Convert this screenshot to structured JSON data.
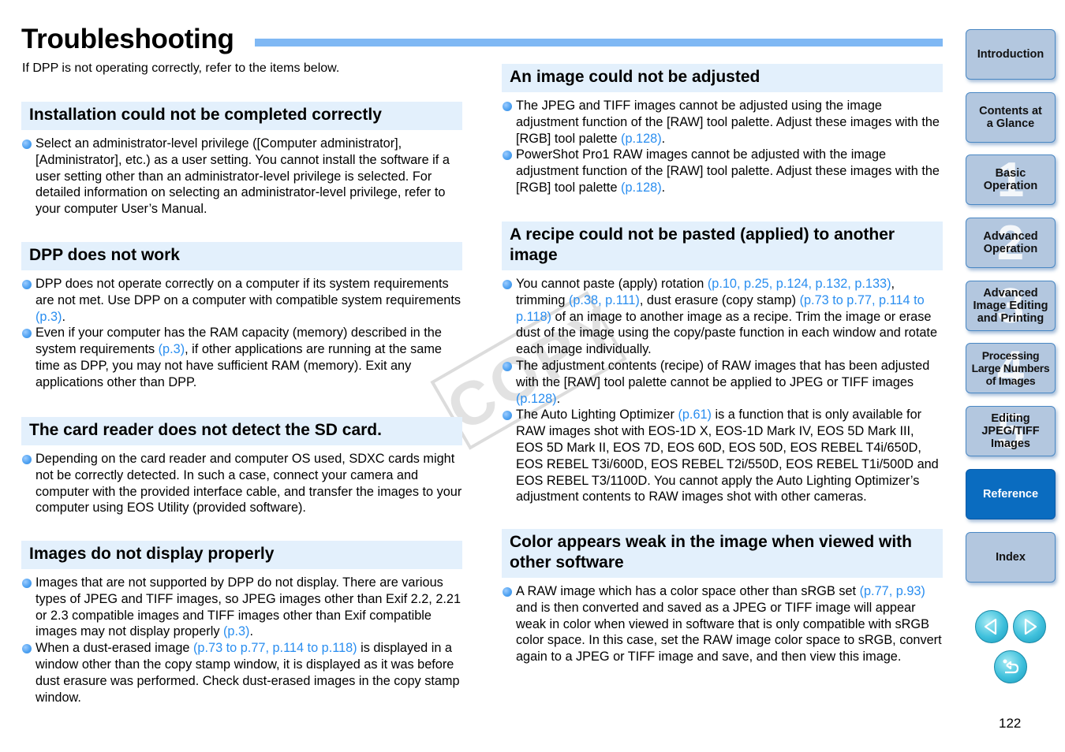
{
  "header": {
    "title": "Troubleshooting",
    "intro": "If DPP is not operating correctly, refer to the items below."
  },
  "sections": [
    {
      "heading": "Installation could not be completed correctly",
      "bullets": [
        [
          {
            "t": "Select an administrator-level privilege ([Computer administrator], [Administrator], etc.) as a user setting. You cannot install the software if a user setting other than an administrator-level privilege is selected. For detailed information on selecting an administrator-level privilege, refer to your computer User’s Manual."
          }
        ]
      ]
    },
    {
      "heading": "DPP does not work",
      "bullets": [
        [
          {
            "t": "DPP does not operate correctly on a computer if its system requirements are not met. Use DPP on a computer with compatible system requirements "
          },
          {
            "ref": "(p.3)"
          },
          {
            "t": "."
          }
        ],
        [
          {
            "t": "Even if your computer has the RAM capacity (memory) described in the system requirements "
          },
          {
            "ref": "(p.3)"
          },
          {
            "t": ", if other applications are running at the same time as DPP, you may not have sufficient RAM (memory). Exit any applications other than DPP."
          }
        ]
      ]
    },
    {
      "heading": "The card reader does not detect the SD card.",
      "bullets": [
        [
          {
            "t": "Depending on the card reader and computer OS used, SDXC cards might not be correctly detected. In such a case, connect your camera and computer with the provided interface cable, and transfer the images to your computer using EOS Utility (provided software)."
          }
        ]
      ]
    },
    {
      "heading": "Images do not display properly",
      "bullets": [
        [
          {
            "t": "Images that are not supported by DPP do not display. There are various types of JPEG and TIFF images, so JPEG images other than Exif 2.2, 2.21 or 2.3 compatible images and TIFF images other than Exif compatible images may not display properly "
          },
          {
            "ref": "(p.3)"
          },
          {
            "t": "."
          }
        ],
        [
          {
            "t": "When a dust-erased image "
          },
          {
            "ref": "(p.73 to p.77, p.114 to p.118)"
          },
          {
            "t": " is displayed in a window other than the copy stamp window, it is displayed as it was before dust erasure was performed. Check dust-erased images in the copy stamp window."
          }
        ]
      ]
    },
    {
      "heading": "An image could not be adjusted",
      "bullets": [
        [
          {
            "t": "The JPEG and TIFF images cannot be adjusted using the image adjustment function of the [RAW] tool palette. Adjust these images with the [RGB] tool palette "
          },
          {
            "ref": "(p.128)"
          },
          {
            "t": "."
          }
        ],
        [
          {
            "t": "PowerShot Pro1 RAW images cannot be adjusted with the image adjustment function of the [RAW] tool palette. Adjust these images with the [RGB] tool palette "
          },
          {
            "ref": "(p.128)"
          },
          {
            "t": "."
          }
        ]
      ]
    },
    {
      "heading": "A recipe could not be pasted (applied) to another image",
      "bullets": [
        [
          {
            "t": "You cannot paste (apply) rotation "
          },
          {
            "ref": "(p.10, p.25, p.124, p.132, p.133)"
          },
          {
            "t": ", trimming "
          },
          {
            "ref": "(p.38, p.111)"
          },
          {
            "t": ", dust erasure (copy stamp) "
          },
          {
            "ref": "(p.73 to p.77, p.114 to p.118)"
          },
          {
            "t": " of an image to another image as a recipe. Trim the image or erase dust of the image using the copy/paste function in each window and rotate each image individually."
          }
        ],
        [
          {
            "t": "The adjustment contents (recipe) of RAW images that has been adjusted with the [RAW] tool palette cannot be applied to JPEG or TIFF images "
          },
          {
            "ref": "(p.128)"
          },
          {
            "t": "."
          }
        ],
        [
          {
            "t": "The Auto Lighting Optimizer "
          },
          {
            "ref": "(p.61)"
          },
          {
            "t": " is a function that is only available for RAW images shot with EOS-1D X, EOS-1D Mark IV, EOS 5D Mark III, EOS 5D Mark II, EOS 7D, EOS 60D, EOS 50D, EOS REBEL T4i/650D, EOS REBEL T3i/600D, EOS REBEL T2i/550D, EOS REBEL T1i/500D and EOS REBEL T3/1100D. You cannot apply the Auto Lighting Optimizer’s adjustment contents to RAW images shot with other cameras."
          }
        ]
      ]
    },
    {
      "heading": "Color appears weak in the image when viewed with other software",
      "bullets": [
        [
          {
            "t": "A RAW image which has a color space other than sRGB set "
          },
          {
            "ref": "(p.77, p.93)"
          },
          {
            "t": " and is then converted and saved as a JPEG or TIFF image will appear weak in color when viewed in software that is only compatible with sRGB color space. In this case, set the RAW image color space to sRGB, convert again to a JPEG or TIFF image and save, and then view this image."
          }
        ]
      ]
    }
  ],
  "watermark": "COPY",
  "sidebar": {
    "items": [
      {
        "label": "Introduction",
        "num": ""
      },
      {
        "label": "Contents at\na Glance",
        "num": ""
      },
      {
        "label": "Basic\nOperation",
        "num": "1"
      },
      {
        "label": "Advanced\nOperation",
        "num": "2"
      },
      {
        "label": "Advanced\nImage Editing\nand Printing",
        "num": "3"
      },
      {
        "label": "Processing\nLarge Numbers\nof Images",
        "num": "4"
      },
      {
        "label": "Editing\nJPEG/TIFF\nImages",
        "num": "5"
      },
      {
        "label": "Reference",
        "num": "",
        "active": true
      },
      {
        "label": "Index",
        "num": ""
      }
    ],
    "prev_icon": "triangle-left-icon",
    "next_icon": "triangle-right-icon",
    "back_icon": "return-arrow-icon"
  },
  "colors": {
    "accent_bar": "#7fb8f4",
    "section_bg": "#e3f0fc",
    "link": "#2a8ef0",
    "nav_bg": "#b3c7df",
    "nav_active": "#0a6cc0"
  },
  "page_number": "122"
}
